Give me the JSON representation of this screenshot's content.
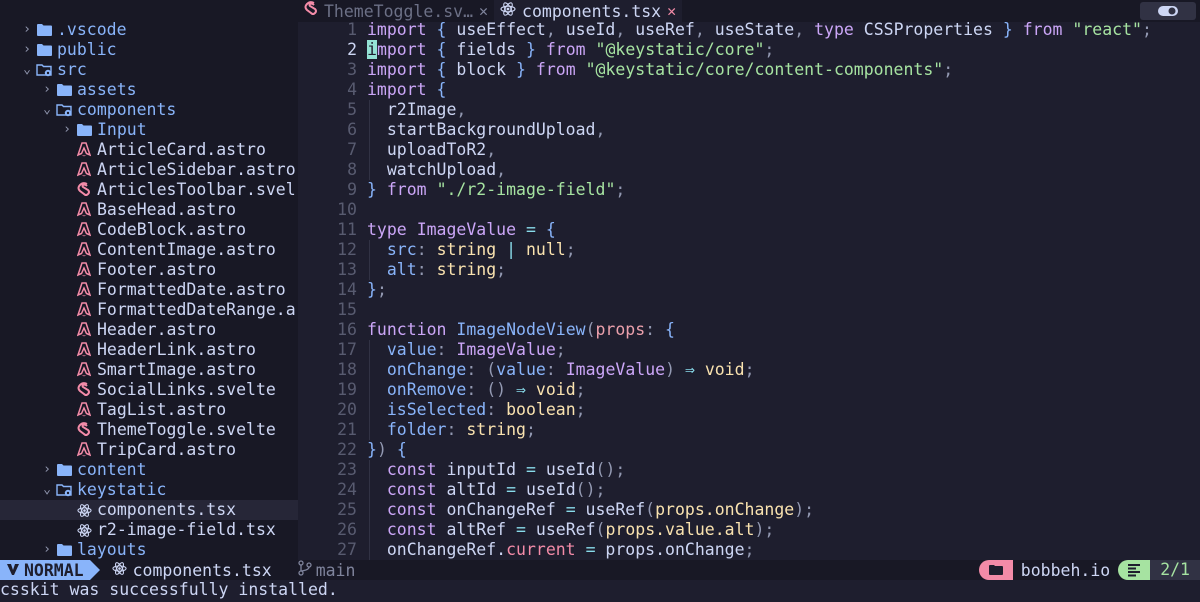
{
  "colors": {
    "bg": "#1e1e2e",
    "sidebar_bg": "#181825",
    "folder": "#89b4fa",
    "astro_icon": "#f38ba8",
    "svelte_icon": "#f38ba8",
    "react_icon": "#cdd6f4",
    "mode_bg": "#89b4fa",
    "project_accent": "#f38ba8",
    "position_accent": "#a6e3a1",
    "cursor": "#94e2d5"
  },
  "tabs": [
    {
      "label": "ThemeToggle.sv…",
      "icon": "svelte-icon",
      "active": false
    },
    {
      "label": "components.tsx",
      "icon": "react-icon",
      "active": true
    }
  ],
  "file_tree": [
    {
      "label": ".vscode",
      "depth": 0,
      "kind": "folder",
      "open": false
    },
    {
      "label": "public",
      "depth": 0,
      "kind": "folder",
      "open": false
    },
    {
      "label": "src",
      "depth": 0,
      "kind": "folder",
      "open": true
    },
    {
      "label": "assets",
      "depth": 1,
      "kind": "folder",
      "open": false
    },
    {
      "label": "components",
      "depth": 1,
      "kind": "folder",
      "open": true
    },
    {
      "label": "Input",
      "depth": 2,
      "kind": "folder",
      "open": false
    },
    {
      "label": "ArticleCard.astro",
      "depth": 2,
      "kind": "astro"
    },
    {
      "label": "ArticleSidebar.astro",
      "depth": 2,
      "kind": "astro"
    },
    {
      "label": "ArticlesToolbar.svel",
      "depth": 2,
      "kind": "svelte"
    },
    {
      "label": "BaseHead.astro",
      "depth": 2,
      "kind": "astro"
    },
    {
      "label": "CodeBlock.astro",
      "depth": 2,
      "kind": "astro"
    },
    {
      "label": "ContentImage.astro",
      "depth": 2,
      "kind": "astro"
    },
    {
      "label": "Footer.astro",
      "depth": 2,
      "kind": "astro"
    },
    {
      "label": "FormattedDate.astro",
      "depth": 2,
      "kind": "astro"
    },
    {
      "label": "FormattedDateRange.a",
      "depth": 2,
      "kind": "astro"
    },
    {
      "label": "Header.astro",
      "depth": 2,
      "kind": "astro"
    },
    {
      "label": "HeaderLink.astro",
      "depth": 2,
      "kind": "astro"
    },
    {
      "label": "SmartImage.astro",
      "depth": 2,
      "kind": "astro"
    },
    {
      "label": "SocialLinks.svelte",
      "depth": 2,
      "kind": "svelte"
    },
    {
      "label": "TagList.astro",
      "depth": 2,
      "kind": "astro"
    },
    {
      "label": "ThemeToggle.svelte",
      "depth": 2,
      "kind": "svelte"
    },
    {
      "label": "TripCard.astro",
      "depth": 2,
      "kind": "astro"
    },
    {
      "label": "content",
      "depth": 1,
      "kind": "folder",
      "open": false
    },
    {
      "label": "keystatic",
      "depth": 1,
      "kind": "folder",
      "open": true
    },
    {
      "label": "components.tsx",
      "depth": 2,
      "kind": "react",
      "selected": true
    },
    {
      "label": "r2-image-field.tsx",
      "depth": 2,
      "kind": "react"
    },
    {
      "label": "layouts",
      "depth": 1,
      "kind": "folder",
      "open": false
    }
  ],
  "editor": {
    "current_line": 2,
    "lines": [
      {
        "n": "1",
        "tokens": [
          [
            "import",
            "kw"
          ],
          [
            " ",
            "var"
          ],
          [
            "{",
            "bkt"
          ],
          [
            " useEffect",
            "var"
          ],
          [
            ",",
            "punc"
          ],
          [
            " useId",
            "var"
          ],
          [
            ",",
            "punc"
          ],
          [
            " useRef",
            "var"
          ],
          [
            ",",
            "punc"
          ],
          [
            " useState",
            "var"
          ],
          [
            ",",
            "punc"
          ],
          [
            " ",
            "var"
          ],
          [
            "type",
            "kw"
          ],
          [
            " CSSProperties ",
            "var"
          ],
          [
            "}",
            "bkt"
          ],
          [
            " ",
            "var"
          ],
          [
            "from",
            "kw"
          ],
          [
            " ",
            "var"
          ],
          [
            "\"react\"",
            "str"
          ],
          [
            ";",
            "punc"
          ]
        ]
      },
      {
        "n": "2",
        "tokens": [
          [
            "i",
            "cursor"
          ],
          [
            "mport",
            "kw"
          ],
          [
            " ",
            "var"
          ],
          [
            "{",
            "bkt"
          ],
          [
            " fields ",
            "var"
          ],
          [
            "}",
            "bkt"
          ],
          [
            " ",
            "var"
          ],
          [
            "from",
            "kw"
          ],
          [
            " ",
            "var"
          ],
          [
            "\"@keystatic/core\"",
            "str"
          ],
          [
            ";",
            "punc"
          ]
        ]
      },
      {
        "n": "3",
        "tokens": [
          [
            "import",
            "kw"
          ],
          [
            " ",
            "var"
          ],
          [
            "{",
            "bkt"
          ],
          [
            " block ",
            "var"
          ],
          [
            "}",
            "bkt"
          ],
          [
            " ",
            "var"
          ],
          [
            "from",
            "kw"
          ],
          [
            " ",
            "var"
          ],
          [
            "\"@keystatic/core/content-components\"",
            "str"
          ],
          [
            ";",
            "punc"
          ]
        ]
      },
      {
        "n": "4",
        "tokens": [
          [
            "import",
            "kw"
          ],
          [
            " ",
            "var"
          ],
          [
            "{",
            "bkt"
          ]
        ]
      },
      {
        "n": "5",
        "tokens": [
          [
            "  r2Image",
            "var"
          ],
          [
            ",",
            "punc"
          ]
        ]
      },
      {
        "n": "6",
        "tokens": [
          [
            "  startBackgroundUpload",
            "var"
          ],
          [
            ",",
            "punc"
          ]
        ]
      },
      {
        "n": "7",
        "tokens": [
          [
            "  uploadToR2",
            "var"
          ],
          [
            ",",
            "punc"
          ]
        ]
      },
      {
        "n": "8",
        "tokens": [
          [
            "  watchUpload",
            "var"
          ],
          [
            ",",
            "punc"
          ]
        ]
      },
      {
        "n": "9",
        "tokens": [
          [
            "}",
            "bkt"
          ],
          [
            " ",
            "var"
          ],
          [
            "from",
            "kw"
          ],
          [
            " ",
            "var"
          ],
          [
            "\"./r2-image-field\"",
            "str"
          ],
          [
            ";",
            "punc"
          ]
        ]
      },
      {
        "n": "10",
        "tokens": []
      },
      {
        "n": "11",
        "tokens": [
          [
            "type",
            "kw"
          ],
          [
            " ",
            "var"
          ],
          [
            "ImageValue",
            "tname"
          ],
          [
            " ",
            "var"
          ],
          [
            "=",
            "op"
          ],
          [
            " ",
            "var"
          ],
          [
            "{",
            "bkt"
          ]
        ]
      },
      {
        "n": "12",
        "tokens": [
          [
            "  ",
            "var"
          ],
          [
            "src",
            "prop"
          ],
          [
            ":",
            "punc"
          ],
          [
            " ",
            "var"
          ],
          [
            "string",
            "type"
          ],
          [
            " ",
            "var"
          ],
          [
            "|",
            "op"
          ],
          [
            " ",
            "var"
          ],
          [
            "null",
            "type"
          ],
          [
            ";",
            "punc"
          ]
        ]
      },
      {
        "n": "13",
        "tokens": [
          [
            "  ",
            "var"
          ],
          [
            "alt",
            "prop"
          ],
          [
            ":",
            "punc"
          ],
          [
            " ",
            "var"
          ],
          [
            "string",
            "type"
          ],
          [
            ";",
            "punc"
          ]
        ]
      },
      {
        "n": "14",
        "tokens": [
          [
            "}",
            "bkt"
          ],
          [
            ";",
            "punc"
          ]
        ]
      },
      {
        "n": "15",
        "tokens": []
      },
      {
        "n": "16",
        "tokens": [
          [
            "function",
            "kw"
          ],
          [
            " ",
            "var"
          ],
          [
            "ImageNodeView",
            "fn"
          ],
          [
            "(",
            "punc"
          ],
          [
            "props",
            "param"
          ],
          [
            ":",
            "punc"
          ],
          [
            " ",
            "var"
          ],
          [
            "{",
            "bkt"
          ]
        ]
      },
      {
        "n": "17",
        "tokens": [
          [
            "  ",
            "var"
          ],
          [
            "value",
            "prop"
          ],
          [
            ":",
            "punc"
          ],
          [
            " ",
            "var"
          ],
          [
            "ImageValue",
            "tname"
          ],
          [
            ";",
            "punc"
          ]
        ]
      },
      {
        "n": "18",
        "tokens": [
          [
            "  ",
            "var"
          ],
          [
            "onChange",
            "prop"
          ],
          [
            ":",
            "punc"
          ],
          [
            " ",
            "var"
          ],
          [
            "(",
            "punc"
          ],
          [
            "value",
            "prop"
          ],
          [
            ":",
            "punc"
          ],
          [
            " ",
            "var"
          ],
          [
            "ImageValue",
            "tname"
          ],
          [
            ")",
            "punc"
          ],
          [
            " ",
            "var"
          ],
          [
            "⇒",
            "op"
          ],
          [
            " ",
            "var"
          ],
          [
            "void",
            "type"
          ],
          [
            ";",
            "punc"
          ]
        ]
      },
      {
        "n": "19",
        "tokens": [
          [
            "  ",
            "var"
          ],
          [
            "onRemove",
            "prop"
          ],
          [
            ":",
            "punc"
          ],
          [
            " ",
            "var"
          ],
          [
            "()",
            "punc"
          ],
          [
            " ",
            "var"
          ],
          [
            "⇒",
            "op"
          ],
          [
            " ",
            "var"
          ],
          [
            "void",
            "type"
          ],
          [
            ";",
            "punc"
          ]
        ]
      },
      {
        "n": "20",
        "tokens": [
          [
            "  ",
            "var"
          ],
          [
            "isSelected",
            "prop"
          ],
          [
            ":",
            "punc"
          ],
          [
            " ",
            "var"
          ],
          [
            "boolean",
            "type"
          ],
          [
            ";",
            "punc"
          ]
        ]
      },
      {
        "n": "21",
        "tokens": [
          [
            "  ",
            "var"
          ],
          [
            "folder",
            "prop"
          ],
          [
            ":",
            "punc"
          ],
          [
            " ",
            "var"
          ],
          [
            "string",
            "type"
          ],
          [
            ";",
            "punc"
          ]
        ]
      },
      {
        "n": "22",
        "tokens": [
          [
            "}",
            "bkt"
          ],
          [
            ")",
            "punc"
          ],
          [
            " ",
            "var"
          ],
          [
            "{",
            "bkt"
          ]
        ]
      },
      {
        "n": "23",
        "tokens": [
          [
            "  ",
            "var"
          ],
          [
            "const",
            "kw"
          ],
          [
            " inputId ",
            "var"
          ],
          [
            "=",
            "op"
          ],
          [
            " useId",
            "var"
          ],
          [
            "()",
            "punc"
          ],
          [
            ";",
            "punc"
          ]
        ]
      },
      {
        "n": "24",
        "tokens": [
          [
            "  ",
            "var"
          ],
          [
            "const",
            "kw"
          ],
          [
            " altId ",
            "var"
          ],
          [
            "=",
            "op"
          ],
          [
            " useId",
            "var"
          ],
          [
            "()",
            "punc"
          ],
          [
            ";",
            "punc"
          ]
        ]
      },
      {
        "n": "25",
        "tokens": [
          [
            "  ",
            "var"
          ],
          [
            "const",
            "kw"
          ],
          [
            " onChangeRef ",
            "var"
          ],
          [
            "=",
            "op"
          ],
          [
            " useRef",
            "var"
          ],
          [
            "(",
            "punc"
          ],
          [
            "props.onChange",
            "arg"
          ],
          [
            ")",
            "punc"
          ],
          [
            ";",
            "punc"
          ]
        ]
      },
      {
        "n": "26",
        "tokens": [
          [
            "  ",
            "var"
          ],
          [
            "const",
            "kw"
          ],
          [
            " altRef ",
            "var"
          ],
          [
            "=",
            "op"
          ],
          [
            " useRef",
            "var"
          ],
          [
            "(",
            "punc"
          ],
          [
            "props.value.alt",
            "arg"
          ],
          [
            ")",
            "punc"
          ],
          [
            ";",
            "punc"
          ]
        ]
      },
      {
        "n": "27",
        "tokens": [
          [
            "  onChangeRef.",
            "var"
          ],
          [
            "current",
            "field"
          ],
          [
            " ",
            "var"
          ],
          [
            "=",
            "op"
          ],
          [
            " props.onChange",
            "var"
          ],
          [
            ";",
            "punc"
          ]
        ]
      }
    ]
  },
  "statusline": {
    "mode": "NORMAL",
    "file": "components.tsx",
    "branch": "main",
    "project": "bobbeh.io",
    "position": "2/1"
  },
  "cmdline": "csskit was successfully installed."
}
